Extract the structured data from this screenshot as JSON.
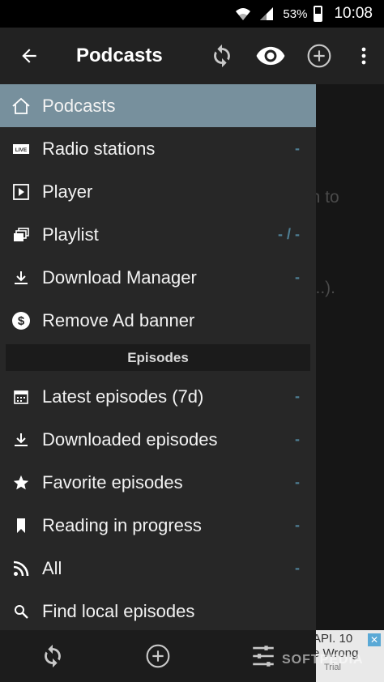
{
  "status_bar": {
    "battery": "53%",
    "time": "10:08"
  },
  "app_bar": {
    "title": "Podcasts",
    "icons": [
      "back-arrow-icon",
      "refresh-icon",
      "eye-icon",
      "add-circle-icon",
      "more-vert-icon"
    ]
  },
  "drawer": {
    "items": [
      {
        "label": "Podcasts",
        "icon": "home-icon",
        "count": "",
        "selected": true
      },
      {
        "label": "Radio stations",
        "icon": "live-icon",
        "count": "-"
      },
      {
        "label": "Player",
        "icon": "player-icon",
        "count": ""
      },
      {
        "label": "Playlist",
        "icon": "playlist-icon",
        "count": "- / -"
      },
      {
        "label": "Download Manager",
        "icon": "download-icon",
        "count": "-"
      },
      {
        "label": "Remove Ad banner",
        "icon": "dollar-icon",
        "count": ""
      }
    ],
    "section_title": "Episodes",
    "episode_items": [
      {
        "label": "Latest episodes (7d)",
        "icon": "calendar-icon",
        "count": "-"
      },
      {
        "label": "Downloaded episodes",
        "icon": "download-icon",
        "count": "-"
      },
      {
        "label": "Favorite episodes",
        "icon": "star-icon",
        "count": "-"
      },
      {
        "label": "Reading in progress",
        "icon": "bookmark-icon",
        "count": "-"
      },
      {
        "label": "All",
        "icon": "rss-icon",
        "count": "-"
      },
      {
        "label": "Find local episodes",
        "icon": "search-icon",
        "count": ""
      }
    ]
  },
  "background_text": {
    "line1": "on to",
    "line2": ", ...)."
  },
  "ad_banner": {
    "line1": "API. 10",
    "line2": "e Wrong",
    "line3": "Trial"
  },
  "watermark": "SOFTPEDIA",
  "colors": {
    "accent": "#4f7f95",
    "selected_bg": "#77909d",
    "drawer_bg": "#272727"
  }
}
